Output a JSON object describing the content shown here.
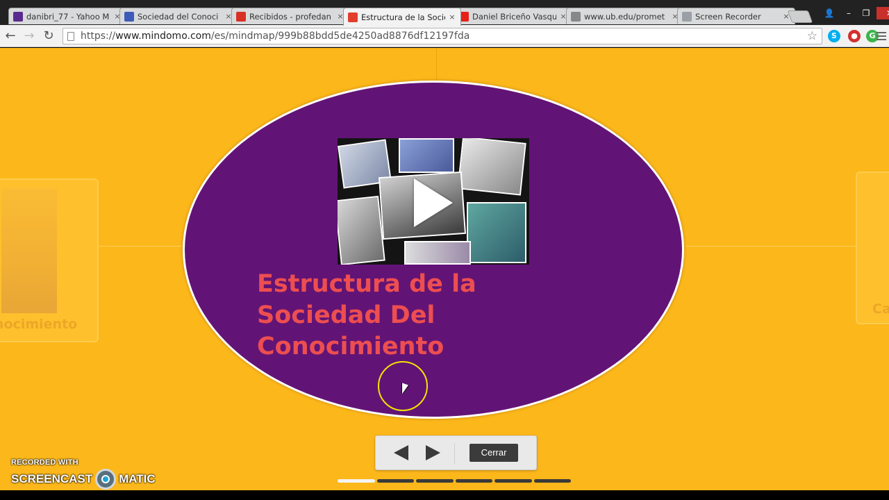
{
  "browser": {
    "tabs": [
      {
        "label": "danibri_77 - Yahoo M",
        "favicon": "yahoo-mail-icon",
        "color": "#5a2b8f",
        "active": false
      },
      {
        "label": "Sociedad del Conoci",
        "favicon": "graduation-cap-icon",
        "color": "#3d5bb8",
        "active": false
      },
      {
        "label": "Recibidos - profedan",
        "favicon": "gmail-icon",
        "color": "#d93025",
        "active": false
      },
      {
        "label": "Estructura de la Socie",
        "favicon": "mindomo-icon",
        "color": "#e23d2d",
        "active": true
      },
      {
        "label": "Daniel Briceño Vasqu",
        "favicon": "youtube-icon",
        "color": "#e62117",
        "active": false
      },
      {
        "label": "www.ub.edu/promet",
        "favicon": "page-icon",
        "color": "#888888",
        "active": false
      },
      {
        "label": "Screen Recorder",
        "favicon": "screen-recorder-icon",
        "color": "#9aa0a6",
        "active": false
      }
    ],
    "tab_close_glyph": "×",
    "url_scheme": "https://",
    "url_host": "www.mindomo.com",
    "url_path": "/es/mindmap/999b88bdd5de4250ad8876df12197fda",
    "extensions": [
      {
        "name": "skype-icon",
        "glyph": "S",
        "color": "#00aff0"
      },
      {
        "name": "record-extension-icon",
        "glyph": "●",
        "color": "#d32f2f"
      },
      {
        "name": "grammar-extension-icon",
        "glyph": "G",
        "color": "#3bb54a"
      }
    ]
  },
  "mindmap": {
    "title_lines": [
      "Estructura de la",
      "Sociedad Del",
      "Conocimiento"
    ],
    "left_ghost_text": "nocimiento",
    "right_ghost_text": "Ca",
    "close_label": "Cerrar",
    "slides_total": 6,
    "slides_done": 1
  },
  "colors": {
    "background": "#fcb71a",
    "node_fill": "#621476",
    "title_text": "#ed4e50"
  },
  "watermark": {
    "line1": "RECORDED WITH",
    "brand_left": "SCREENCAST",
    "brand_right": "MATIC"
  }
}
